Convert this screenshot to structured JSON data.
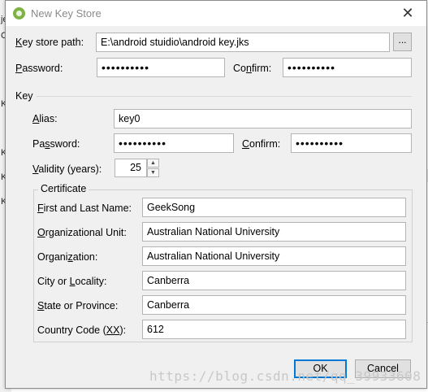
{
  "background": {
    "fragments": [
      "je",
      "OK",
      "Ke",
      "Ke",
      "Ke",
      "Ke"
    ]
  },
  "dialog": {
    "title": "New Key Store",
    "close_glyph": "✕",
    "keystore": {
      "path_label_key": "K",
      "path_label_rest": "ey store path:",
      "path_value": "E:\\android stuidio\\android key.jks",
      "browse_label": "...",
      "password_label_key": "P",
      "password_label_rest": "assword:",
      "password_value": "••••••••••",
      "confirm_label_pre": "Co",
      "confirm_label_key": "n",
      "confirm_label_rest": "firm:",
      "confirm_value": "••••••••••"
    },
    "key": {
      "section_label": "Key",
      "alias_label_key": "A",
      "alias_label_rest": "lias:",
      "alias_value": "key0",
      "password_label_pre": "Pa",
      "password_label_key": "s",
      "password_label_rest": "sword:",
      "password_value": "••••••••••",
      "confirm_label_key": "C",
      "confirm_label_rest": "onfirm:",
      "confirm_value": "••••••••••",
      "validity_label_key": "V",
      "validity_label_rest": "alidity (years):",
      "validity_value": "25",
      "spin_up_glyph": "▲",
      "spin_down_glyph": "▼"
    },
    "certificate": {
      "section_label": "Certificate",
      "first_last_label_key": "F",
      "first_last_label_rest": "irst and Last Name:",
      "first_last_value": "GeekSong",
      "org_unit_label_key": "O",
      "org_unit_label_rest": "rganizational Unit:",
      "org_unit_value": "Australian National University",
      "org_label_pre": "Organi",
      "org_label_key": "z",
      "org_label_rest": "ation:",
      "org_value": "Australian National University",
      "city_label_pre": "City or ",
      "city_label_key": "L",
      "city_label_rest": "ocality:",
      "city_value": "Canberra",
      "state_label_key": "S",
      "state_label_rest": "tate or Province:",
      "state_value": "Canberra",
      "country_label_pre": "Country Code (",
      "country_label_key": "XX",
      "country_label_rest": "):",
      "country_value": "612"
    },
    "buttons": {
      "ok_label": "OK",
      "cancel_label": "Cancel"
    }
  },
  "watermark": "https://blog.csdn.net/qq_39933608",
  "colors": {
    "dialog_bg": "#f0f0f0",
    "ok_border": "#0078d7",
    "app_icon": "#7cb342"
  }
}
